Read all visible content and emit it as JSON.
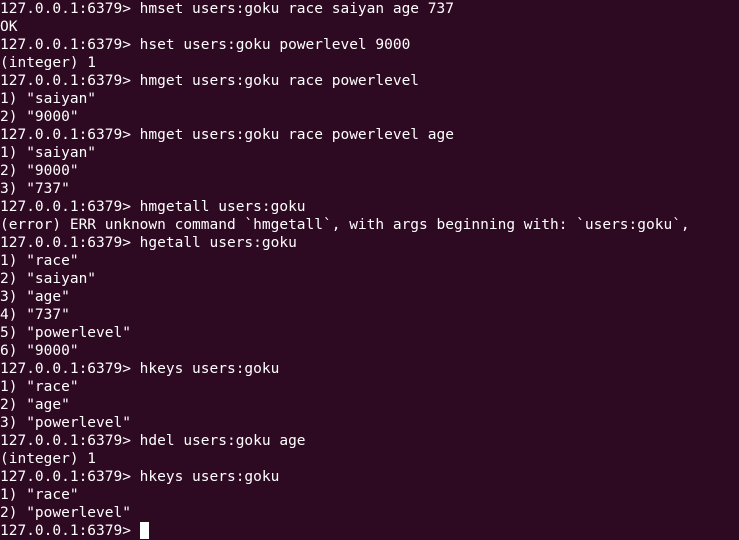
{
  "terminal": {
    "lines": [
      "127.0.0.1:6379> hmset users:goku race saiyan age 737",
      "OK",
      "127.0.0.1:6379> hset users:goku powerlevel 9000",
      "(integer) 1",
      "127.0.0.1:6379> hmget users:goku race powerlevel",
      "1) \"saiyan\"",
      "2) \"9000\"",
      "127.0.0.1:6379> hmget users:goku race powerlevel age",
      "1) \"saiyan\"",
      "2) \"9000\"",
      "3) \"737\"",
      "127.0.0.1:6379> hmgetall users:goku",
      "(error) ERR unknown command `hmgetall`, with args beginning with: `users:goku`,",
      "127.0.0.1:6379> hgetall users:goku",
      "1) \"race\"",
      "2) \"saiyan\"",
      "3) \"age\"",
      "4) \"737\"",
      "5) \"powerlevel\"",
      "6) \"9000\"",
      "127.0.0.1:6379> hkeys users:goku",
      "1) \"race\"",
      "2) \"age\"",
      "3) \"powerlevel\"",
      "127.0.0.1:6379> hdel users:goku age",
      "(integer) 1",
      "127.0.0.1:6379> hkeys users:goku",
      "1) \"race\"",
      "2) \"powerlevel\""
    ],
    "current_prompt": "127.0.0.1:6379> ",
    "background_color": "#2d0922",
    "text_color": "#ffffff"
  }
}
